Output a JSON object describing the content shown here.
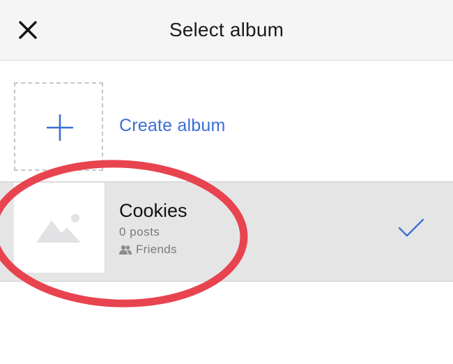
{
  "header": {
    "title": "Select album",
    "close_icon": "close-icon"
  },
  "create": {
    "label": "Create album",
    "icon": "plus-icon"
  },
  "album": {
    "title": "Cookies",
    "posts": "0 posts",
    "privacy": "Friends",
    "privacy_icon": "friends-icon",
    "thumbnail_icon": "image-placeholder-icon",
    "selected": true,
    "selected_icon": "check-icon"
  },
  "colors": {
    "accent": "#3a6fd6",
    "header_bg": "#f5f5f6",
    "selected_row_bg": "#e5e5e6",
    "annotation": "#e8444f"
  }
}
